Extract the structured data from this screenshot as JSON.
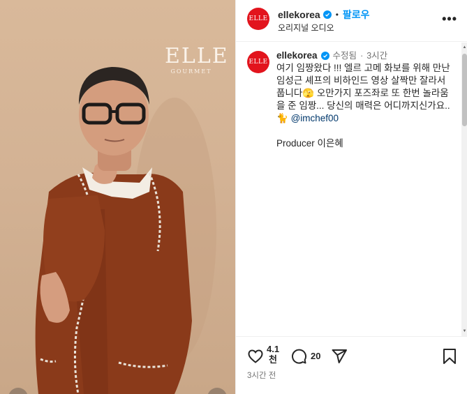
{
  "media": {
    "logo_main": "ELLE",
    "logo_sub": "GOURMET"
  },
  "header": {
    "avatar_text": "ELLE",
    "username": "ellekorea",
    "separator": "•",
    "follow_label": "팔로우",
    "subtitle": "오리지널 오디오",
    "more_label": "•••"
  },
  "caption": {
    "avatar_text": "ELLE",
    "username": "ellekorea",
    "edited": "수정됨",
    "dot": "·",
    "time_ago": "3시간",
    "text": "여기 임짱왔다 !!! 엘르 고메 화보를 위해 만난 임성근 셰프의 비하인드 영상 살짝만 잘라서 풉니다🫣 오만가지 포즈좌로 또 한번 놀라움을 준 임짱... 당신의 매력은 어디까지신가요..🐈 ",
    "mention": "@imchef00",
    "producer": "Producer 이은혜"
  },
  "actions": {
    "like_count_line1": "4.1",
    "like_count_line2": "천",
    "comment_count": "20",
    "timestamp": "3시간 전"
  },
  "colors": {
    "brand_red": "#e2141d",
    "link_blue": "#0095f6",
    "mention_blue": "#00376b",
    "muted_text": "#737373"
  },
  "icons": {
    "like": "heart-icon",
    "comment": "comment-icon",
    "share": "share-icon",
    "save": "bookmark-icon",
    "verified": "verified-badge-icon"
  }
}
